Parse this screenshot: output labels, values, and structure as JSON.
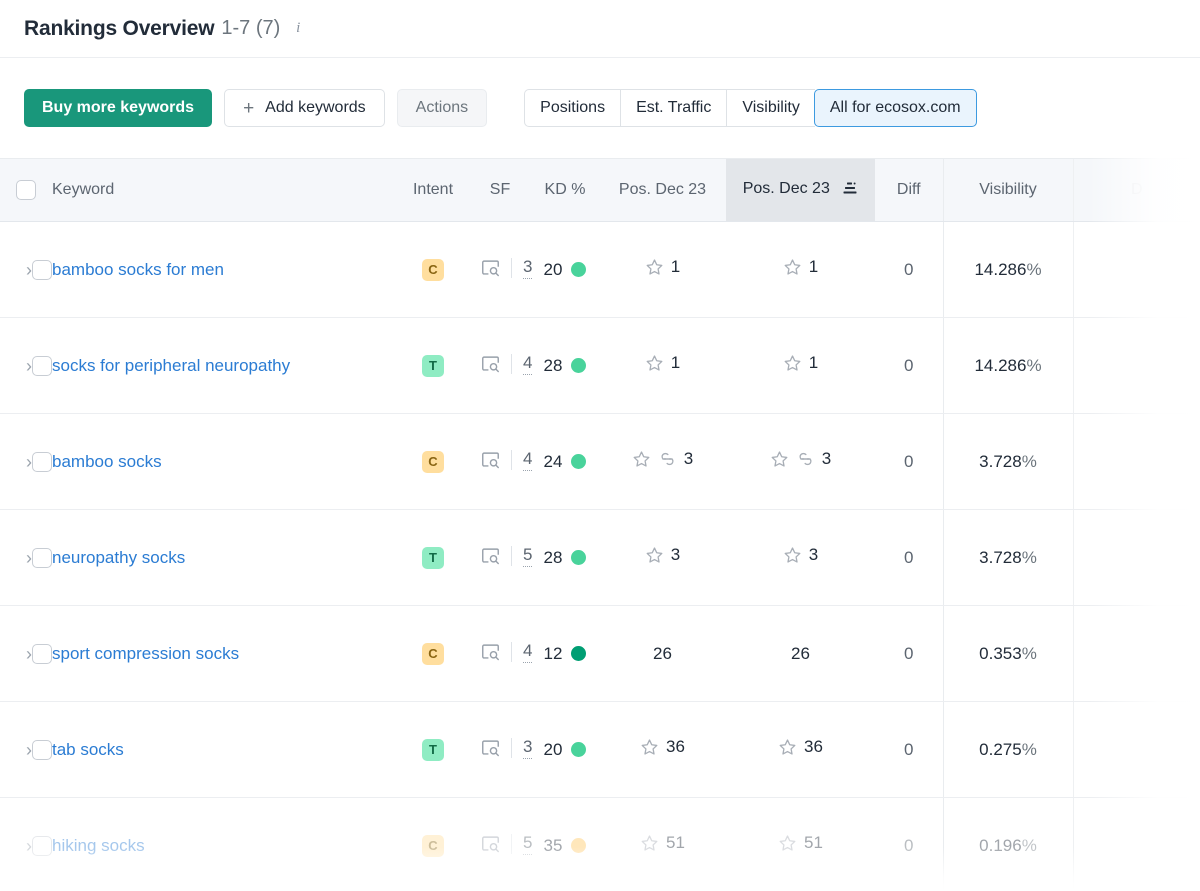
{
  "header": {
    "title": "Rankings Overview",
    "range": "1-7 (7)",
    "info_icon": "info-icon"
  },
  "toolbar": {
    "buy_more_keywords": "Buy more keywords",
    "add_keywords": "Add keywords",
    "add_keywords_plus": "+",
    "actions": "Actions",
    "segments": [
      {
        "label": "Positions",
        "active": false
      },
      {
        "label": "Est. Traffic",
        "active": false
      },
      {
        "label": "Visibility",
        "active": false
      },
      {
        "label": "All for ecosox.com",
        "active": true
      }
    ]
  },
  "table": {
    "columns": {
      "keyword": "Keyword",
      "intent": "Intent",
      "sf": "SF",
      "kd": "KD %",
      "pos1": "Pos. Dec 23",
      "pos2": "Pos. Dec 23",
      "diff": "Diff",
      "visibility": "Visibility",
      "tail": "D"
    },
    "sorted_column": "pos2",
    "sort_icon": "sort-descending-icon",
    "rows": [
      {
        "keyword": "bamboo socks for men",
        "intent": "C",
        "sf_count": "3",
        "kd": "20",
        "kd_color": "#49d39b",
        "pos1": "1",
        "pos1_star": true,
        "pos1_link": false,
        "pos2": "1",
        "pos2_star": true,
        "pos2_link": false,
        "diff": "0",
        "visibility": "14.286",
        "faded": false
      },
      {
        "keyword": "socks for peripheral neuropathy",
        "intent": "T",
        "sf_count": "4",
        "kd": "28",
        "kd_color": "#49d39b",
        "pos1": "1",
        "pos1_star": true,
        "pos1_link": false,
        "pos2": "1",
        "pos2_star": true,
        "pos2_link": false,
        "diff": "0",
        "visibility": "14.286",
        "faded": false
      },
      {
        "keyword": "bamboo socks",
        "intent": "C",
        "sf_count": "4",
        "kd": "24",
        "kd_color": "#49d39b",
        "pos1": "3",
        "pos1_star": true,
        "pos1_link": true,
        "pos2": "3",
        "pos2_star": true,
        "pos2_link": true,
        "diff": "0",
        "visibility": "3.728",
        "faded": false
      },
      {
        "keyword": "neuropathy socks",
        "intent": "T",
        "sf_count": "5",
        "kd": "28",
        "kd_color": "#49d39b",
        "pos1": "3",
        "pos1_star": true,
        "pos1_link": false,
        "pos2": "3",
        "pos2_star": true,
        "pos2_link": false,
        "diff": "0",
        "visibility": "3.728",
        "faded": false
      },
      {
        "keyword": "sport compression socks",
        "intent": "C",
        "sf_count": "4",
        "kd": "12",
        "kd_color": "#009e73",
        "pos1": "26",
        "pos1_star": false,
        "pos1_link": false,
        "pos2": "26",
        "pos2_star": false,
        "pos2_link": false,
        "diff": "0",
        "visibility": "0.353",
        "faded": false
      },
      {
        "keyword": "tab socks",
        "intent": "T",
        "sf_count": "3",
        "kd": "20",
        "kd_color": "#49d39b",
        "pos1": "36",
        "pos1_star": true,
        "pos1_link": false,
        "pos2": "36",
        "pos2_star": true,
        "pos2_link": false,
        "diff": "0",
        "visibility": "0.275",
        "faded": false
      },
      {
        "keyword": "hiking socks",
        "intent": "C",
        "sf_count": "5",
        "kd": "35",
        "kd_color": "#ffc75f",
        "pos1": "51",
        "pos1_star": true,
        "pos1_link": false,
        "pos2": "51",
        "pos2_star": true,
        "pos2_link": false,
        "diff": "0",
        "visibility": "0.196",
        "faded": true
      }
    ]
  },
  "colors": {
    "brand_green": "#19977b",
    "link_blue": "#2b7cd3",
    "accent_blue": "#3d9ae0",
    "intent_commercial_bg": "#ffde9e",
    "intent_transactional_bg": "#8fecc3"
  }
}
